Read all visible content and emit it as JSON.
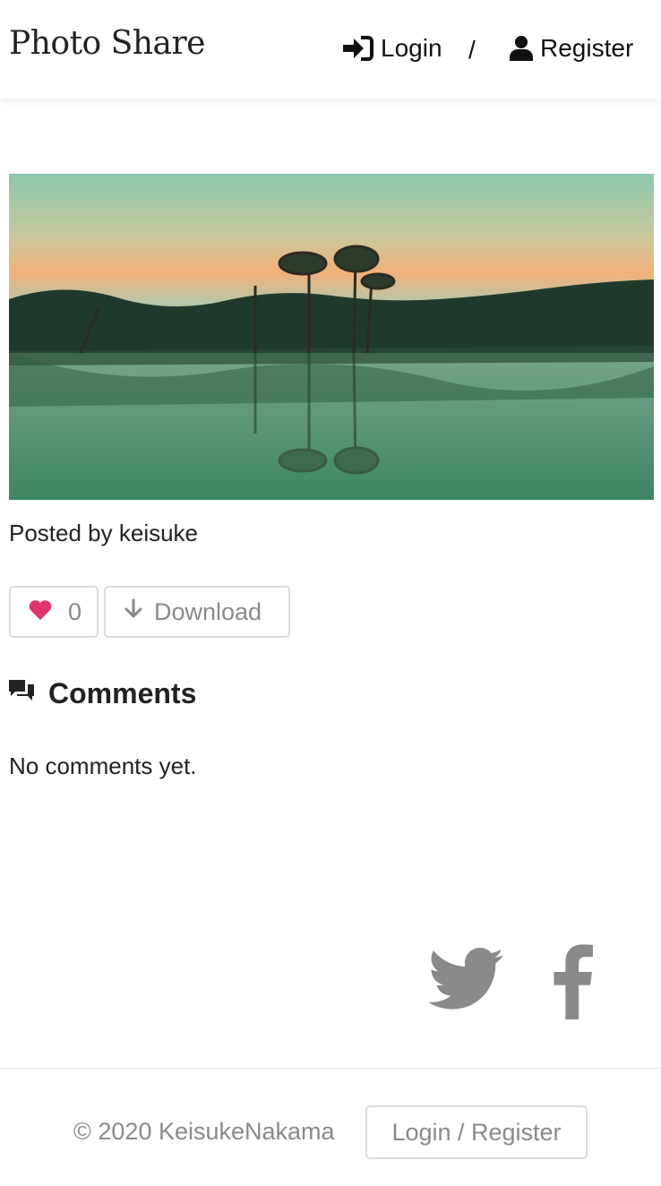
{
  "header": {
    "brand": "Photo Share",
    "login_label": "Login",
    "separator": "/",
    "register_label": "Register"
  },
  "post": {
    "posted_by": "Posted by keisuke",
    "like_count": "0",
    "download_label": "Download"
  },
  "comments": {
    "title": "Comments",
    "empty_text": "No comments yet."
  },
  "social": {
    "icons": [
      "twitter-icon",
      "facebook-icon"
    ]
  },
  "footer": {
    "copyright": "© 2020 KeisukeNakama",
    "login_register_label": "Login / Register"
  },
  "colors": {
    "heart": "#e0336b",
    "muted": "#8a8a8a",
    "social": "#8a8a8a"
  }
}
